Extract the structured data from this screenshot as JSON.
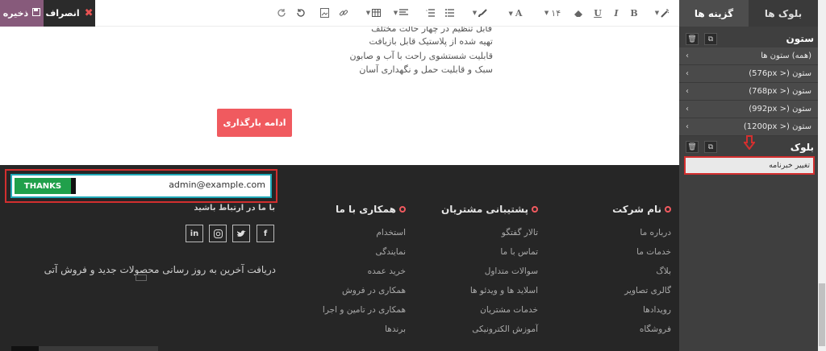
{
  "toolbar": {
    "save_label": "ذخیره",
    "discard_label": "انصراف",
    "font_size": "۱۴"
  },
  "canvas": {
    "features": [
      "قابل تنظیم در چهار حالت مختلف",
      "تهیه شده از پلاستیک قابل بازیافت",
      "قابلیت شستشوی راحت با آب و صابون",
      "سبک و قابلیت حمل و نگهداری آسان"
    ],
    "load_more_label": "ادامه بارگذاری"
  },
  "footer": {
    "columns": [
      {
        "title": "نام شرکت",
        "links": [
          "درباره ما",
          "خدمات ما",
          "بلاگ",
          "گالری تصاویر",
          "رویدادها",
          "فروشگاه"
        ]
      },
      {
        "title": "پشتیبانی مشتریان",
        "links": [
          "تالار گفتگو",
          "تماس با ما",
          "سوالات متداول",
          "اسلاید ها و ویدئو ها",
          "خدمات مشتریان",
          "آموزش الکترونیکی"
        ]
      },
      {
        "title": "همکاری با ما",
        "links": [
          "استخدام",
          "نمایندگی",
          "خرید عمده",
          "همکاری در فروش",
          "همکاری در تامین و اجرا",
          "برندها"
        ]
      }
    ],
    "contact_title": "با ما در ارتباط باشید",
    "social": [
      "facebook-icon",
      "twitter-icon",
      "instagram-icon",
      "linkedin-icon"
    ],
    "newsletter_text": "دریافت آخرین به روز رسانی محصولات جدید و فروش آتی",
    "newsletter_button": "THANKS",
    "newsletter_email": "admin@example.com"
  },
  "panel": {
    "tab_blocks": "بلوک ها",
    "tab_options": "گزینه ها",
    "column_title": "ستون",
    "column_rows": [
      "(همه) ستون ها",
      "ستون (< 576px)",
      "ستون (< 768px)",
      "ستون (< 992px)",
      "ستون (< 1200px)"
    ],
    "block_title": "بلوک",
    "change_newsletter": "تغییر خبرنامه"
  },
  "colors": {
    "accent": "#875a7b",
    "load_more": "#f05a5f",
    "thanks": "#20a04b",
    "highlight": "#d32f2f"
  }
}
